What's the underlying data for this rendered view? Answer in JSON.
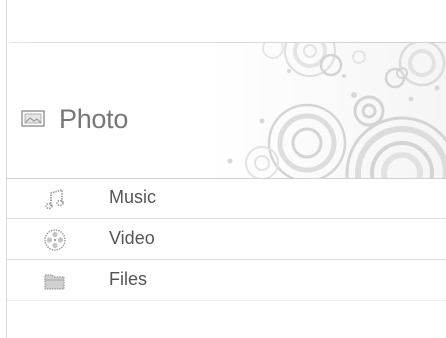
{
  "header": {
    "title": "Photo",
    "icon": "photo-icon"
  },
  "menu": {
    "items": [
      {
        "label": "Music",
        "icon": "music-icon"
      },
      {
        "label": "Video",
        "icon": "video-reel-icon"
      },
      {
        "label": "Files",
        "icon": "folder-icon"
      }
    ]
  },
  "colors": {
    "title_text": "#777777",
    "item_text": "#555555",
    "decor": "#d0d0d0"
  }
}
